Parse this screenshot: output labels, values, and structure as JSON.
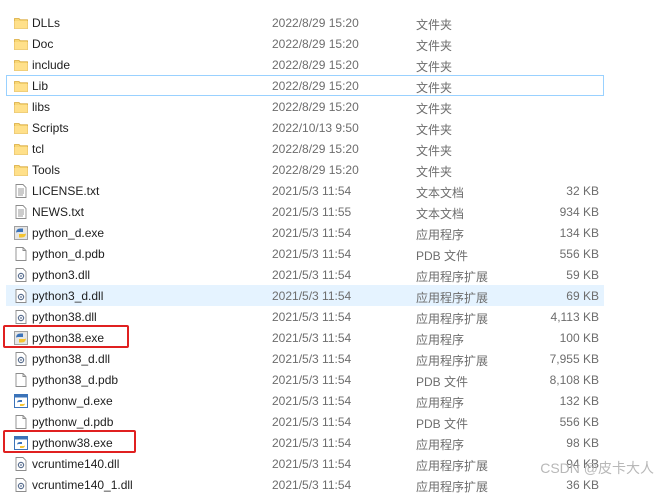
{
  "files": [
    {
      "name": "DLLs",
      "date": "2022/8/29 15:20",
      "type": "文件夹",
      "size": "",
      "icon": "folder-icon"
    },
    {
      "name": "Doc",
      "date": "2022/8/29 15:20",
      "type": "文件夹",
      "size": "",
      "icon": "folder-icon"
    },
    {
      "name": "include",
      "date": "2022/8/29 15:20",
      "type": "文件夹",
      "size": "",
      "icon": "folder-icon"
    },
    {
      "name": "Lib",
      "date": "2022/8/29 15:20",
      "type": "文件夹",
      "size": "",
      "icon": "folder-icon"
    },
    {
      "name": "libs",
      "date": "2022/8/29 15:20",
      "type": "文件夹",
      "size": "",
      "icon": "folder-icon"
    },
    {
      "name": "Scripts",
      "date": "2022/10/13 9:50",
      "type": "文件夹",
      "size": "",
      "icon": "folder-icon"
    },
    {
      "name": "tcl",
      "date": "2022/8/29 15:20",
      "type": "文件夹",
      "size": "",
      "icon": "folder-icon"
    },
    {
      "name": "Tools",
      "date": "2022/8/29 15:20",
      "type": "文件夹",
      "size": "",
      "icon": "folder-icon"
    },
    {
      "name": "LICENSE.txt",
      "date": "2021/5/3 11:54",
      "type": "文本文档",
      "size": "32 KB",
      "icon": "text-file-icon"
    },
    {
      "name": "NEWS.txt",
      "date": "2021/5/3 11:55",
      "type": "文本文档",
      "size": "934 KB",
      "icon": "text-file-icon"
    },
    {
      "name": "python_d.exe",
      "date": "2021/5/3 11:54",
      "type": "应用程序",
      "size": "134 KB",
      "icon": "python-exe-icon"
    },
    {
      "name": "python_d.pdb",
      "date": "2021/5/3 11:54",
      "type": "PDB 文件",
      "size": "556 KB",
      "icon": "blank-file-icon"
    },
    {
      "name": "python3.dll",
      "date": "2021/5/3 11:54",
      "type": "应用程序扩展",
      "size": "59 KB",
      "icon": "dll-file-icon"
    },
    {
      "name": "python3_d.dll",
      "date": "2021/5/3 11:54",
      "type": "应用程序扩展",
      "size": "69 KB",
      "icon": "dll-file-icon"
    },
    {
      "name": "python38.dll",
      "date": "2021/5/3 11:54",
      "type": "应用程序扩展",
      "size": "4,113 KB",
      "icon": "dll-file-icon"
    },
    {
      "name": "python38.exe",
      "date": "2021/5/3 11:54",
      "type": "应用程序",
      "size": "100 KB",
      "icon": "python-exe-icon"
    },
    {
      "name": "python38_d.dll",
      "date": "2021/5/3 11:54",
      "type": "应用程序扩展",
      "size": "7,955 KB",
      "icon": "dll-file-icon"
    },
    {
      "name": "python38_d.pdb",
      "date": "2021/5/3 11:54",
      "type": "PDB 文件",
      "size": "8,108 KB",
      "icon": "blank-file-icon"
    },
    {
      "name": "pythonw_d.exe",
      "date": "2021/5/3 11:54",
      "type": "应用程序",
      "size": "132 KB",
      "icon": "pythonw-exe-icon"
    },
    {
      "name": "pythonw_d.pdb",
      "date": "2021/5/3 11:54",
      "type": "PDB 文件",
      "size": "556 KB",
      "icon": "blank-file-icon"
    },
    {
      "name": "pythonw38.exe",
      "date": "2021/5/3 11:54",
      "type": "应用程序",
      "size": "98 KB",
      "icon": "pythonw-exe-icon"
    },
    {
      "name": "vcruntime140.dll",
      "date": "2021/5/3 11:54",
      "type": "应用程序扩展",
      "size": "94 KB",
      "icon": "dll-file-icon"
    },
    {
      "name": "vcruntime140_1.dll",
      "date": "2021/5/3 11:54",
      "type": "应用程序扩展",
      "size": "36 KB",
      "icon": "dll-file-icon"
    }
  ],
  "focused_row": "Lib",
  "hover_row": "python3_d.dll",
  "highlighted_rows": [
    "python38.exe",
    "pythonw38.exe"
  ],
  "highlight_color": "#e02020",
  "watermark": "CSDN @皮卡大人"
}
